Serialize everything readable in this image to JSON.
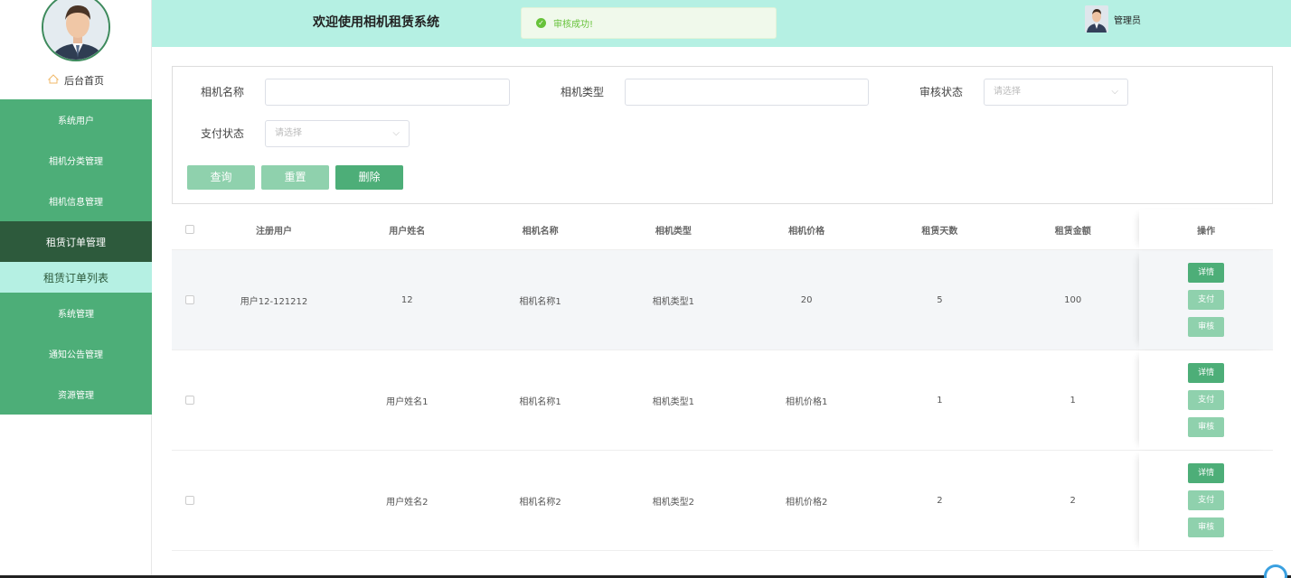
{
  "header": {
    "title": "欢迎使用相机租赁系统",
    "toast": "审核成功!",
    "admin_label": "管理员"
  },
  "sidebar": {
    "home": "后台首页",
    "items": [
      {
        "label": "系统用户"
      },
      {
        "label": "相机分类管理"
      },
      {
        "label": "相机信息管理"
      },
      {
        "label": "租赁订单管理"
      },
      {
        "label": "租赁订单列表"
      },
      {
        "label": "系统管理"
      },
      {
        "label": "通知公告管理"
      },
      {
        "label": "资源管理"
      }
    ]
  },
  "search": {
    "camera_name_label": "相机名称",
    "camera_type_label": "相机类型",
    "audit_status_label": "审核状态",
    "audit_status_placeholder": "请选择",
    "pay_status_label": "支付状态",
    "pay_status_placeholder": "请选择",
    "query_button": "查询",
    "reset_button": "重置",
    "delete_button": "删除"
  },
  "table": {
    "headers": [
      "注册用户",
      "用户姓名",
      "相机名称",
      "相机类型",
      "相机价格",
      "租赁天数",
      "租赁金额",
      "操作"
    ],
    "rows": [
      [
        "用户12-121212",
        "12",
        "相机名称1",
        "相机类型1",
        "20",
        "5",
        "100"
      ],
      [
        "",
        "用户姓名1",
        "相机名称1",
        "相机类型1",
        "相机价格1",
        "1",
        "1"
      ],
      [
        "",
        "用户姓名2",
        "相机名称2",
        "相机类型2",
        "相机价格2",
        "2",
        "2"
      ]
    ],
    "op_detail": "详情",
    "op_pay": "支付",
    "op_audit": "审核"
  },
  "colors": {
    "menu_green": "#4dae78",
    "menu_active": "#2d5a3c",
    "header_bg": "#b5f0e3",
    "button_light": "#8fd1ad"
  }
}
